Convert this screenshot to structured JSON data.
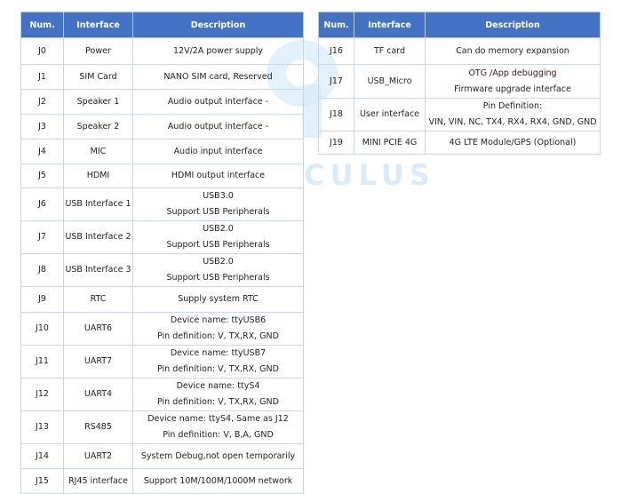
{
  "watermark": {
    "text": "CULUS"
  },
  "headers": {
    "num": "Num.",
    "interface": "Interface",
    "description": "Description"
  },
  "table_left": [
    {
      "num": "J0",
      "interface": "Power",
      "description": [
        "12V/2A power supply"
      ]
    },
    {
      "num": "J1",
      "interface": "SIM Card",
      "description": [
        "NANO SIM card, Reserved"
      ]
    },
    {
      "num": "J2",
      "interface": "Speaker 1",
      "description": [
        "Audio output interface -"
      ]
    },
    {
      "num": "J3",
      "interface": "Speaker 2",
      "description": [
        "Audio output interface -"
      ]
    },
    {
      "num": "J4",
      "interface": "MIC",
      "description": [
        "Audio input interface"
      ]
    },
    {
      "num": "J5",
      "interface": "HDMI",
      "description": [
        "HDMI output interface"
      ]
    },
    {
      "num": "J6",
      "interface": "USB Interface 1",
      "description": [
        "USB3.0",
        "Support USB Peripherals"
      ]
    },
    {
      "num": "J7",
      "interface": "USB Interface 2",
      "description": [
        "USB2.0",
        "Support USB Peripherals"
      ]
    },
    {
      "num": "J8",
      "interface": "USB Interface 3",
      "description": [
        "USB2.0",
        "Support USB Peripherals"
      ]
    },
    {
      "num": "J9",
      "interface": "RTC",
      "description": [
        "Supply system RTC"
      ]
    },
    {
      "num": "J10",
      "interface": "UART6",
      "description": [
        "Device name: ttyUSB6",
        "Pin definition: V, TX,RX, GND"
      ]
    },
    {
      "num": "J11",
      "interface": "UART7",
      "description": [
        "Device name: ttyUSB7",
        "Pin definition: V, TX,RX, GND"
      ]
    },
    {
      "num": "J12",
      "interface": "UART4",
      "description": [
        "Device name: ttyS4",
        "Pin definition: V, TX,RX, GND"
      ]
    },
    {
      "num": "J13",
      "interface": "RS485",
      "description": [
        "Device name: ttyS4, Same as J12",
        "Pin definition: V, B,A, GND"
      ]
    },
    {
      "num": "J14",
      "interface": "UART2",
      "description": [
        "System Debug,not open temporarily"
      ]
    },
    {
      "num": "J15",
      "interface": "RJ45 interface",
      "description": [
        "Support 10M/100M/1000M network"
      ]
    }
  ],
  "table_right": [
    {
      "num": "J16",
      "interface": "TF card",
      "description": [
        "Can do memory expansion"
      ]
    },
    {
      "num": "J17",
      "interface": "USB_Micro",
      "description": [
        "OTG /App debugging",
        "Firmware upgrade interface"
      ]
    },
    {
      "num": "J18",
      "interface": "User interface",
      "description": [
        "Pin Definition:",
        "VIN, VIN, NC, TX4, RX4, RX4, GND, GND"
      ]
    },
    {
      "num": "J19",
      "interface": "MINI PCIE 4G",
      "description": [
        "4G LTE Module/GPS (Optional)"
      ]
    }
  ]
}
